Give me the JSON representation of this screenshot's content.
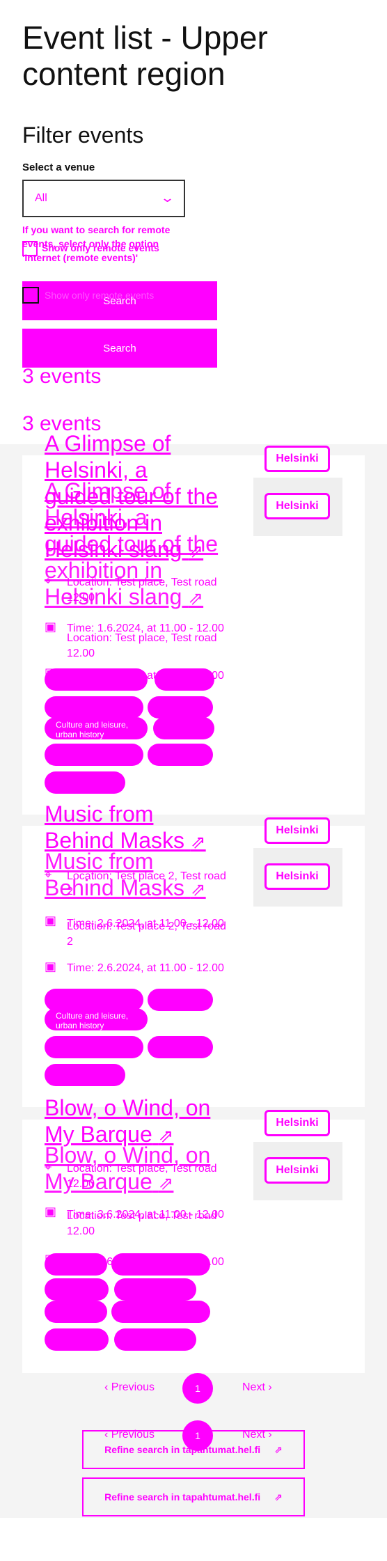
{
  "page_title": "Event list - Upper content region",
  "filters": {
    "heading": "Filter events",
    "venue_label": "Select a venue",
    "venue_value": "All",
    "remote_help": "If you want to search for remote events, select only the option 'Internet (remote events)'",
    "remote_checkbox_label": "Show only remote events",
    "remote_checkbox_label_2": "Show only remote events",
    "search_label": "Search",
    "search_label_2": "Search"
  },
  "result_count": "3 events",
  "result_count_2": "3 events",
  "logo_text": "Helsinki",
  "events": [
    {
      "title": "A Glimpse of Helsinki, a guided tour of the exhibition in Helsinki slang",
      "location": "Location: Test place, Test road 12.00",
      "time": "Time: 1.6.2024, at 11.00 - 12.00",
      "tag": "Culture and leisure, urban history"
    },
    {
      "title": "Music from Behind Masks",
      "location": "Location: Test place 2, Test road 2",
      "time": "Time: 2.6.2024, at 11.00 - 12.00",
      "tag": "Culture and leisure, urban history"
    },
    {
      "title": "Blow, o Wind, on My Barque",
      "location": "Location: Test place, Test road 12.00",
      "time": "Time: 3.6.2024, at 11.00 - 12.00",
      "tag": ""
    }
  ],
  "pagination": {
    "previous": "Previous",
    "current": "1",
    "next": "Next"
  },
  "refine_label": "Refine search in tapahtumat.hel.fi",
  "colors": {
    "accent": "#ff00ff",
    "background": "#f4f4f4"
  }
}
